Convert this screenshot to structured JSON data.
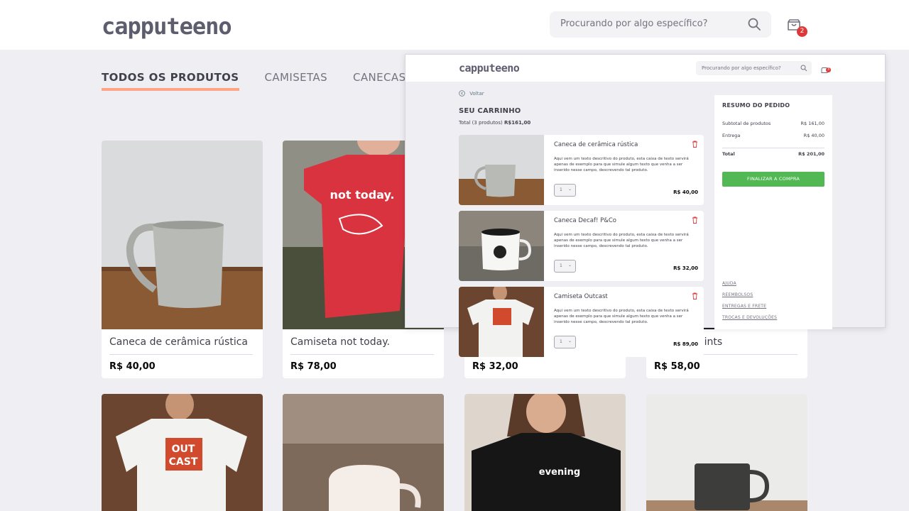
{
  "header": {
    "logo": "capputeeno",
    "search_placeholder": "Procurando por algo específico?",
    "cart_count": "2"
  },
  "tabs": [
    "TODOS OS PRODUTOS",
    "CAMISETAS",
    "CANECAS"
  ],
  "products": [
    {
      "name": "Caneca de cerâmica rústica",
      "price": "R$ 40,00"
    },
    {
      "name": "Camiseta not today.",
      "price": "R$ 78,00"
    },
    {
      "name": "",
      "price": "R$ 32,00"
    },
    {
      "name": "Broken Saints",
      "price": "R$ 58,00"
    }
  ],
  "shirt_text": "not today.",
  "outcast_text": [
    "OUT",
    "CAST"
  ],
  "evening_text": "evening",
  "cart_overlay": {
    "logo": "capputeeno",
    "search_placeholder": "Procurando por algo específico?",
    "cart_count": "3",
    "back": "Voltar",
    "title": "SEU CARRINHO",
    "total_label": "Total (3 produtos)",
    "total_value": "R$161,00",
    "items": [
      {
        "name": "Caneca de cerâmica rústica",
        "desc": "Aqui vem um texto descritivo do produto, esta caixa de texto servirá apenas de exemplo para que simule algum texto que venha a ser inserido nesse campo, descrevendo tal produto.",
        "qty": "1",
        "price": "R$ 40,00"
      },
      {
        "name": "Caneca Decaf! P&Co",
        "desc": "Aqui vem um texto descritivo do produto, esta caixa de texto servirá apenas de exemplo para que simule algum texto que venha a ser inserido nesse campo, descrevendo tal produto.",
        "qty": "1",
        "price": "R$ 32,00"
      },
      {
        "name": "Camiseta Outcast",
        "desc": "Aqui vem um texto descritivo do produto, esta caixa de texto servirá apenas de exemplo para que simule algum texto que venha a ser inserido nesse campo, descrevendo tal produto.",
        "qty": "1",
        "price": "R$ 89,00"
      }
    ],
    "summary": {
      "title": "RESUMO DO PEDIDO",
      "subtotal_label": "Subtotal de produtos",
      "subtotal": "R$ 161,00",
      "shipping_label": "Entrega",
      "shipping": "R$ 40,00",
      "total_label": "Total",
      "total": "R$ 201,00",
      "buy": "FINALIZAR A COMPRA",
      "links": [
        "AJUDA",
        "REEMBOLSOS",
        "ENTREGAS E FRETE",
        "TROCAS E DEVOLUÇÕES"
      ]
    }
  },
  "colors": {
    "accent": "#ffa585",
    "badge": "#de3838",
    "buy": "#51b853"
  }
}
